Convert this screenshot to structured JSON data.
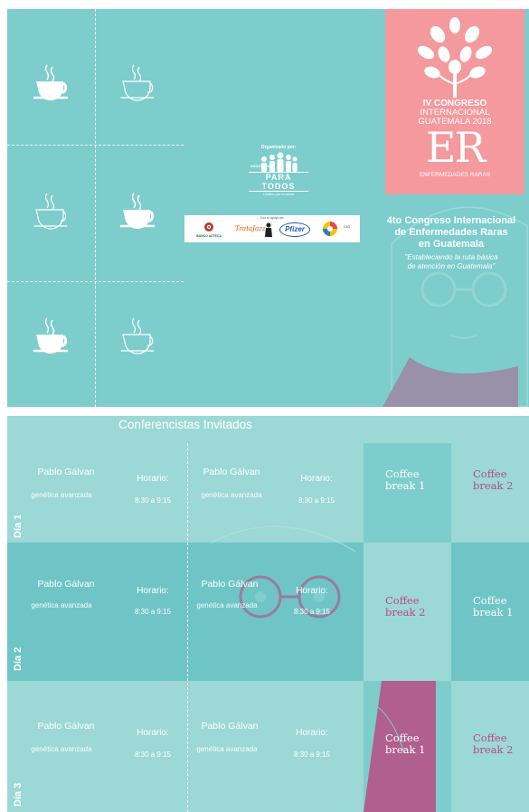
{
  "header": {
    "organized_by": "Organizado por:",
    "org_name_small": "ASOCIACIÓN",
    "org_name_big": "PARA TODOS",
    "org_tagline": "Unidos por la salud",
    "sponsors_label": "Con el apoyo de:",
    "sponsors": [
      "BANCO AZTECA",
      "TrataJazz",
      "Pfizer",
      "CIG"
    ]
  },
  "congress": {
    "line1": "IV CONGRESO",
    "line2": "INTERNACIONAL",
    "line3": "GUATEMALA 2018",
    "acronym": "ER",
    "subtitle": "ENFERMEDADES RARAS",
    "title_lines": [
      "4to Congreso Internacional",
      "de Enfermedades Raras",
      "en Guatemala"
    ],
    "quote_lines": [
      "\"Estableciendo la ruta básica",
      "de atención en Guatemala\""
    ]
  },
  "schedule": {
    "heading": "Conferencistas Invitados",
    "days": [
      {
        "label": "Día 1",
        "speakers": [
          {
            "name": "Pablo Gálvan",
            "topic": "genética avanzada",
            "horario_label": "Horario:",
            "time": "8:30 a 9:15"
          },
          {
            "name": "Pablo Gálvan",
            "topic": "genética avanzada",
            "horario_label": "Horario:",
            "time": "8:30 a 9:15"
          }
        ],
        "breaks": [
          "Coffee break 1",
          "Coffee break 2"
        ]
      },
      {
        "label": "Día 2",
        "speakers": [
          {
            "name": "Pablo Gálvan",
            "topic": "genética avanzada",
            "horario_label": "Horario:",
            "time": "8:30 a 9:15"
          },
          {
            "name": "Pablo Gálvan",
            "topic": "genética avanzada",
            "horario_label": "Horario:",
            "time": "8:30 a 9:15"
          }
        ],
        "breaks": [
          "Coffee break 2",
          "Coffee break 1"
        ]
      },
      {
        "label": "Día 3",
        "speakers": [
          {
            "name": "Pablo Gálvan",
            "topic": "genética avanzada",
            "horario_label": "Horario:",
            "time": "8:30 a 9:15"
          },
          {
            "name": "Pablo Gálvan",
            "topic": "genética avanzada",
            "horario_label": "Horario:",
            "time": "8:30 a 9:15"
          }
        ],
        "breaks": [
          "Coffee break 1",
          "Coffee break 2"
        ]
      }
    ]
  },
  "colors": {
    "teal_main": "#7dcdcd",
    "teal_light": "#9cd8d5",
    "teal_dark": "#6fc5c6",
    "pink": "#f4999d",
    "magenta": "#b84b82"
  }
}
